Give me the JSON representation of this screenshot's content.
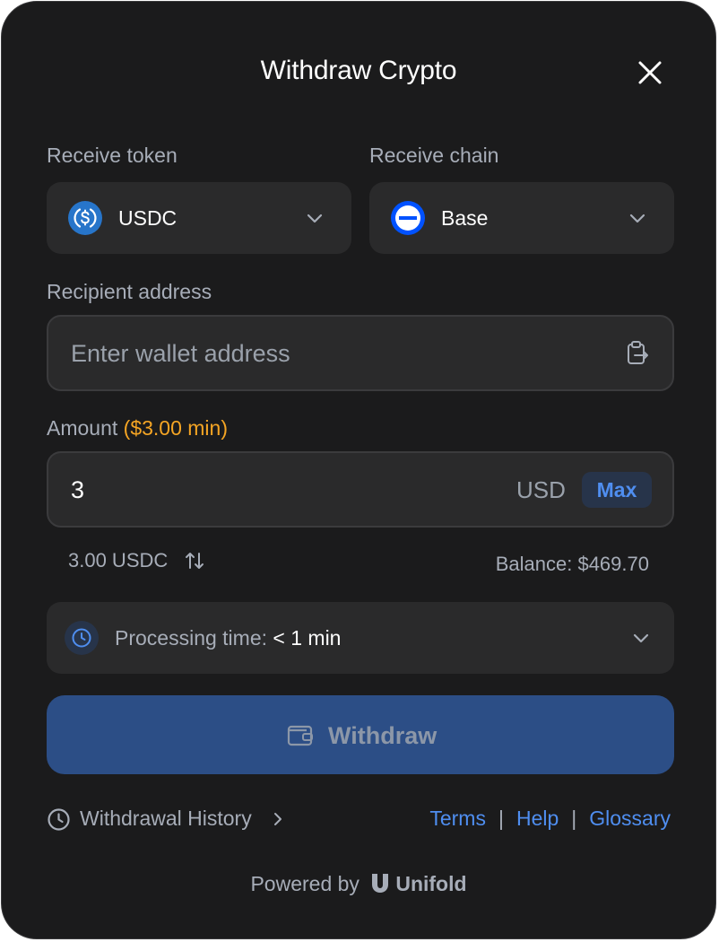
{
  "header": {
    "title": "Withdraw Crypto"
  },
  "token": {
    "label": "Receive token",
    "value": "USDC",
    "icon": "usdc-coin-icon"
  },
  "chain": {
    "label": "Receive chain",
    "value": "Base",
    "icon": "base-chain-icon"
  },
  "recipient": {
    "label": "Recipient address",
    "placeholder": "Enter wallet address",
    "paste_icon": "paste-clipboard-icon"
  },
  "amount": {
    "label": "Amount",
    "min_label": "($3.00 min)",
    "value": "3",
    "unit": "USD",
    "max_label": "Max",
    "converted": "3.00 USDC",
    "balance": "Balance: $469.70"
  },
  "processing": {
    "label": "Processing time:",
    "value": "< 1 min"
  },
  "actions": {
    "withdraw_label": "Withdraw"
  },
  "footer": {
    "history_label": "Withdrawal History",
    "terms": "Terms",
    "help": "Help",
    "glossary": "Glossary",
    "separator": "|",
    "powered_by": "Powered by",
    "brand": "Unifold"
  },
  "colors": {
    "background": "#1b1b1c",
    "field": "#2a2a2b",
    "accent": "#4f8ef0",
    "min_highlight": "#f5a524",
    "withdraw_button": "#2c4e86",
    "usdc": "#2775ca",
    "base": "#0052ff"
  }
}
